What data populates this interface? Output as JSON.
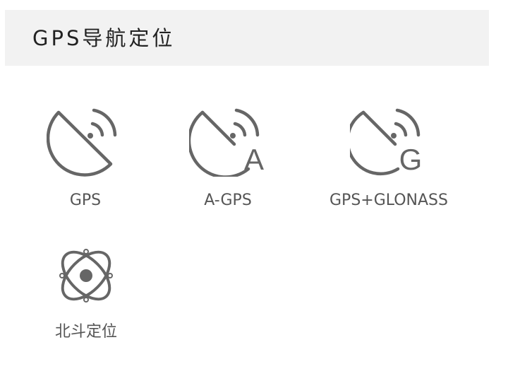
{
  "section": {
    "title": "GPS导航定位"
  },
  "features": [
    {
      "label": "GPS",
      "icon": "satellite-dish-icon"
    },
    {
      "label": "A-GPS",
      "icon": "satellite-dish-a-icon"
    },
    {
      "label": "GPS+GLONASS",
      "icon": "satellite-dish-g-icon"
    },
    {
      "label": "北斗定位",
      "icon": "atom-orbit-icon"
    }
  ],
  "colors": {
    "icon_stroke": "#666666",
    "label_text": "#555555",
    "title_text": "#222222",
    "header_background": "#f2f2f2"
  }
}
